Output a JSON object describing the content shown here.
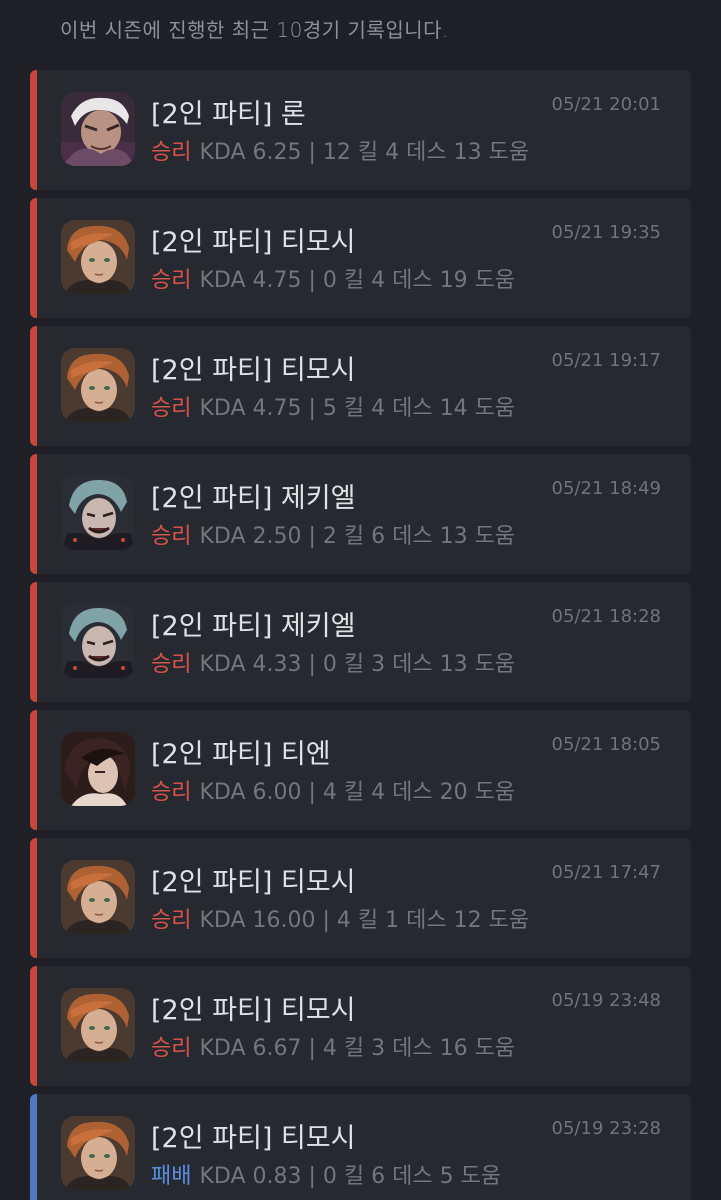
{
  "header": {
    "intro_text": "이번 시즌에 진행한 최근 10경기 기록입니다."
  },
  "colors": {
    "win": "#d9524a",
    "loss": "#5a8ee0",
    "background": "#1e2025",
    "card": "#26292f"
  },
  "matches": [
    {
      "title": "[2인 파티] 론",
      "time": "05/21 20:01",
      "result": "승리",
      "outcome": "win",
      "stats": "KDA 6.25 | 12 킬 4 데스 13 도움",
      "avatar": "ron"
    },
    {
      "title": "[2인 파티] 티모시",
      "time": "05/21 19:35",
      "result": "승리",
      "outcome": "win",
      "stats": "KDA 4.75 | 0 킬 4 데스 19 도움",
      "avatar": "timothy"
    },
    {
      "title": "[2인 파티] 티모시",
      "time": "05/21 19:17",
      "result": "승리",
      "outcome": "win",
      "stats": "KDA 4.75 | 5 킬 4 데스 14 도움",
      "avatar": "timothy"
    },
    {
      "title": "[2인 파티] 제키엘",
      "time": "05/21 18:49",
      "result": "승리",
      "outcome": "win",
      "stats": "KDA 2.50 | 2 킬 6 데스 13 도움",
      "avatar": "jekiel"
    },
    {
      "title": "[2인 파티] 제키엘",
      "time": "05/21 18:28",
      "result": "승리",
      "outcome": "win",
      "stats": "KDA 4.33 | 0 킬 3 데스 13 도움",
      "avatar": "jekiel"
    },
    {
      "title": "[2인 파티] 티엔",
      "time": "05/21 18:05",
      "result": "승리",
      "outcome": "win",
      "stats": "KDA 6.00 | 4 킬 4 데스 20 도움",
      "avatar": "tien"
    },
    {
      "title": "[2인 파티] 티모시",
      "time": "05/21 17:47",
      "result": "승리",
      "outcome": "win",
      "stats": "KDA 16.00 | 4 킬 1 데스 12 도움",
      "avatar": "timothy"
    },
    {
      "title": "[2인 파티] 티모시",
      "time": "05/19 23:48",
      "result": "승리",
      "outcome": "win",
      "stats": "KDA 6.67 | 4 킬 3 데스 16 도움",
      "avatar": "timothy"
    },
    {
      "title": "[2인 파티] 티모시",
      "time": "05/19 23:28",
      "result": "패배",
      "outcome": "loss",
      "stats": "KDA 0.83 | 0 킬 6 데스 5 도움",
      "avatar": "timothy"
    }
  ]
}
